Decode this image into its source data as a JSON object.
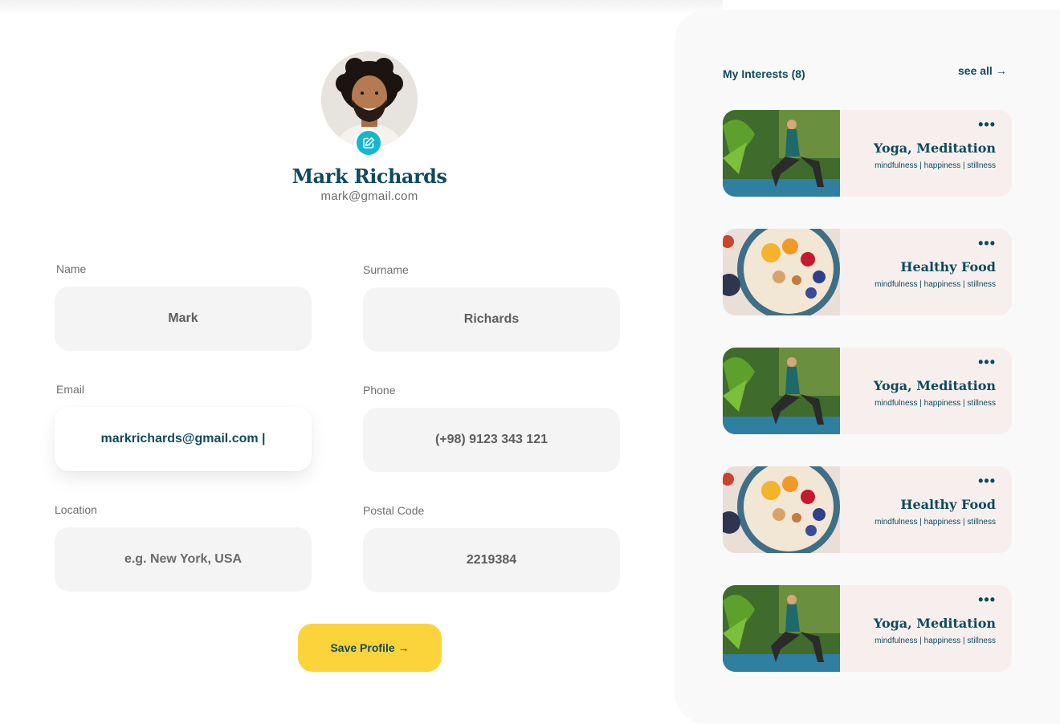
{
  "profile": {
    "name": "Mark Richards",
    "email": "mark@gmail.com",
    "avatar_icon": "user-avatar-photo",
    "edit_icon": "pencil-edit-icon"
  },
  "form": {
    "name_label": "Name",
    "name_value": "Mark",
    "surname_label": "Surname",
    "surname_value": "Richards",
    "email_label": "Email",
    "email_value": "markrichards@gmail.com |",
    "phone_label": "Phone",
    "phone_value": "(+98) 9123 343 121",
    "location_label": "Location",
    "location_placeholder": "e.g. New York, USA",
    "postal_label": "Postal Code",
    "postal_value": "2219384",
    "save_label": "Save Profile →"
  },
  "interests": {
    "title": "My Interests (8)",
    "see_all": "see all →",
    "items": [
      {
        "title": "Yoga, Meditation",
        "tags": "mindfulness | happiness | stillness",
        "image": "yoga-photo",
        "more": "•••"
      },
      {
        "title": "Healthy Food",
        "tags": "mindfulness | happiness | stillness",
        "image": "food-bowl-photo",
        "more": "•••"
      },
      {
        "title": "Yoga, Meditation",
        "tags": "mindfulness | happiness | stillness",
        "image": "yoga-photo",
        "more": "•••"
      },
      {
        "title": "Healthy Food",
        "tags": "mindfulness | happiness | stillness",
        "image": "food-bowl-photo",
        "more": "•••"
      },
      {
        "title": "Yoga, Meditation",
        "tags": "mindfulness | happiness | stillness",
        "image": "yoga-photo",
        "more": "•••"
      }
    ]
  },
  "colors": {
    "primary": "#0e4a5c",
    "accent_button": "#fbd33a",
    "edit_badge": "#17b6cf",
    "card_background": "#f6efee",
    "input_background": "#f4f4f4"
  }
}
